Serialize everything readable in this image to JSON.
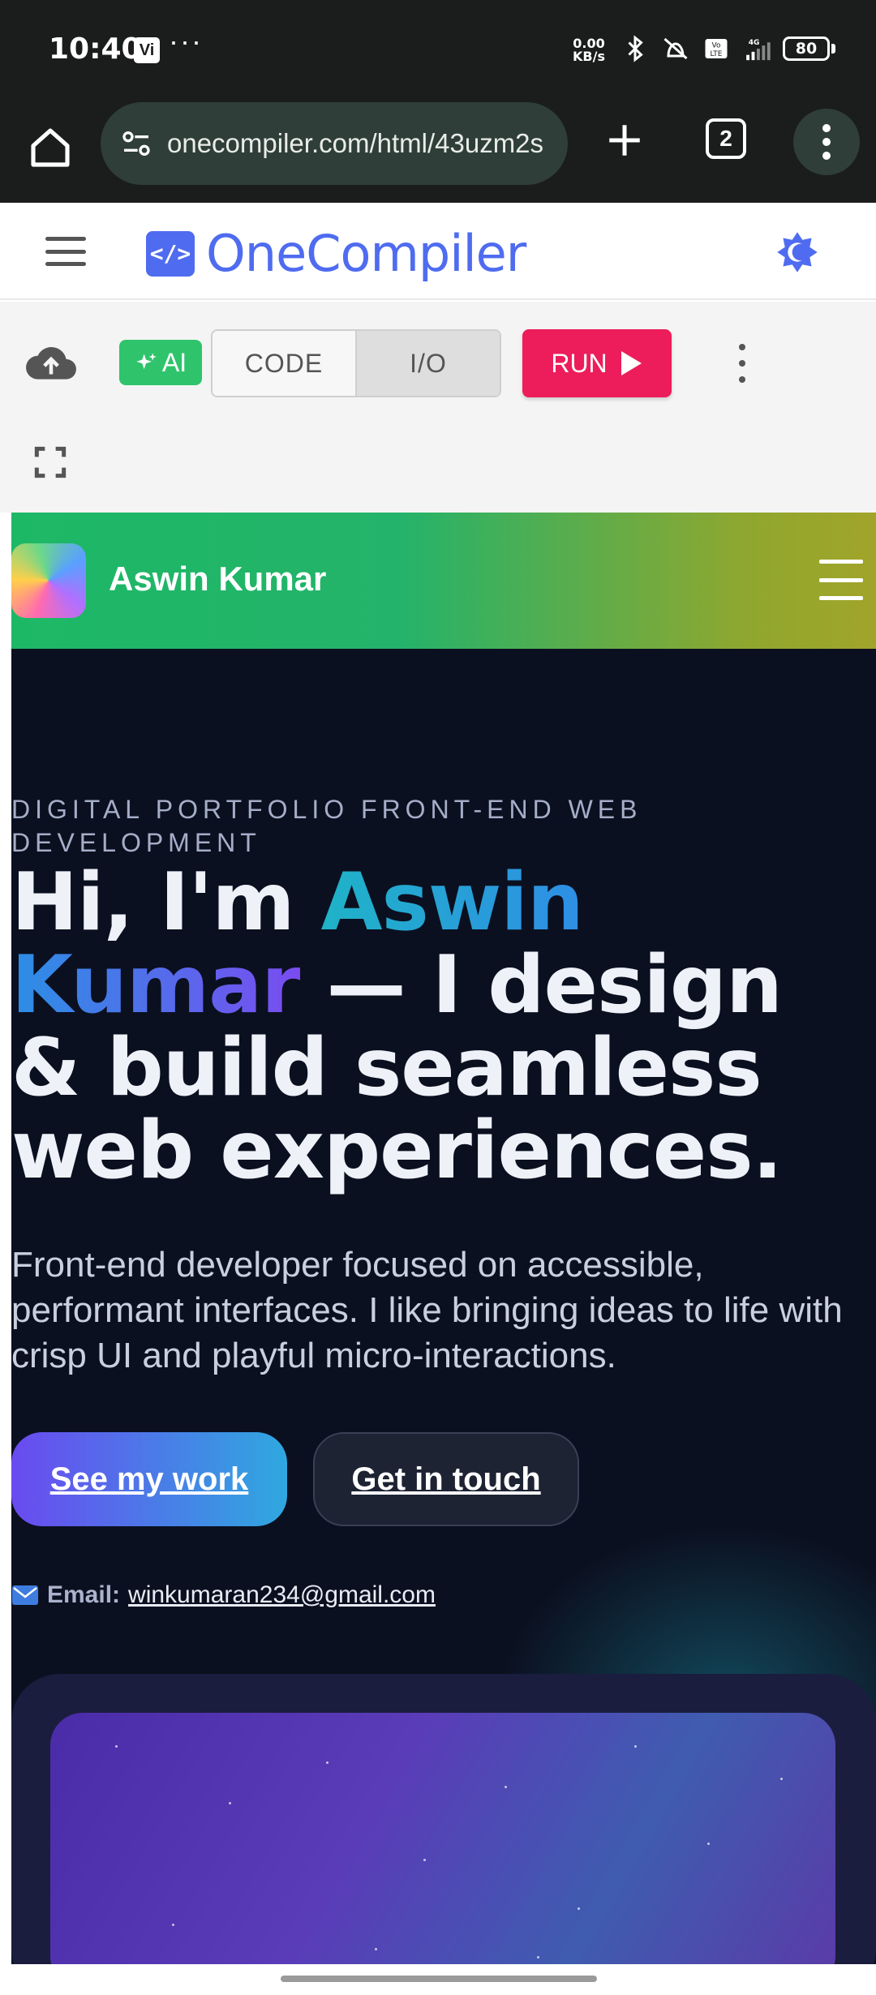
{
  "status_bar": {
    "time": "10:40",
    "carrier_badge": "Vi",
    "more_indicator": "···",
    "net_speed_value": "0.00",
    "net_speed_unit": "KB/s",
    "network_type": "4G",
    "battery": "80"
  },
  "browser": {
    "url": "onecompiler.com/html/43uzm2s",
    "tab_count": "2"
  },
  "onecompiler": {
    "logo_mark": "</>",
    "logo_text": "OneCompiler",
    "toolbar": {
      "ai_label": "AI",
      "code_tab": "CODE",
      "io_tab": "I/O",
      "run_label": "RUN"
    }
  },
  "preview": {
    "nav_name": "Aswin Kumar",
    "eyebrow": "DIGITAL PORTFOLIO FRONT-END WEB DEVELOPMENT",
    "hero_prefix": "Hi, I'm ",
    "hero_name": "Aswin Kumar",
    "hero_suffix": " — I design & build seamless web experiences.",
    "hero_sub": "Front-end developer focused on accessible, performant interfaces. I like bringing ideas to life with crisp UI and playful micro-interactions.",
    "cta_primary": "See my work",
    "cta_secondary": "Get in touch",
    "email_label": "Email:",
    "email_address": "winkumaran234@gmail.com"
  },
  "colors": {
    "brand_blue": "#4f6cf0",
    "run_red": "#ec1d5a",
    "ai_green": "#2fc46b",
    "nav_gradient_start": "#1db866",
    "nav_gradient_end": "#a2a42a",
    "page_dark": "#0b1020"
  }
}
